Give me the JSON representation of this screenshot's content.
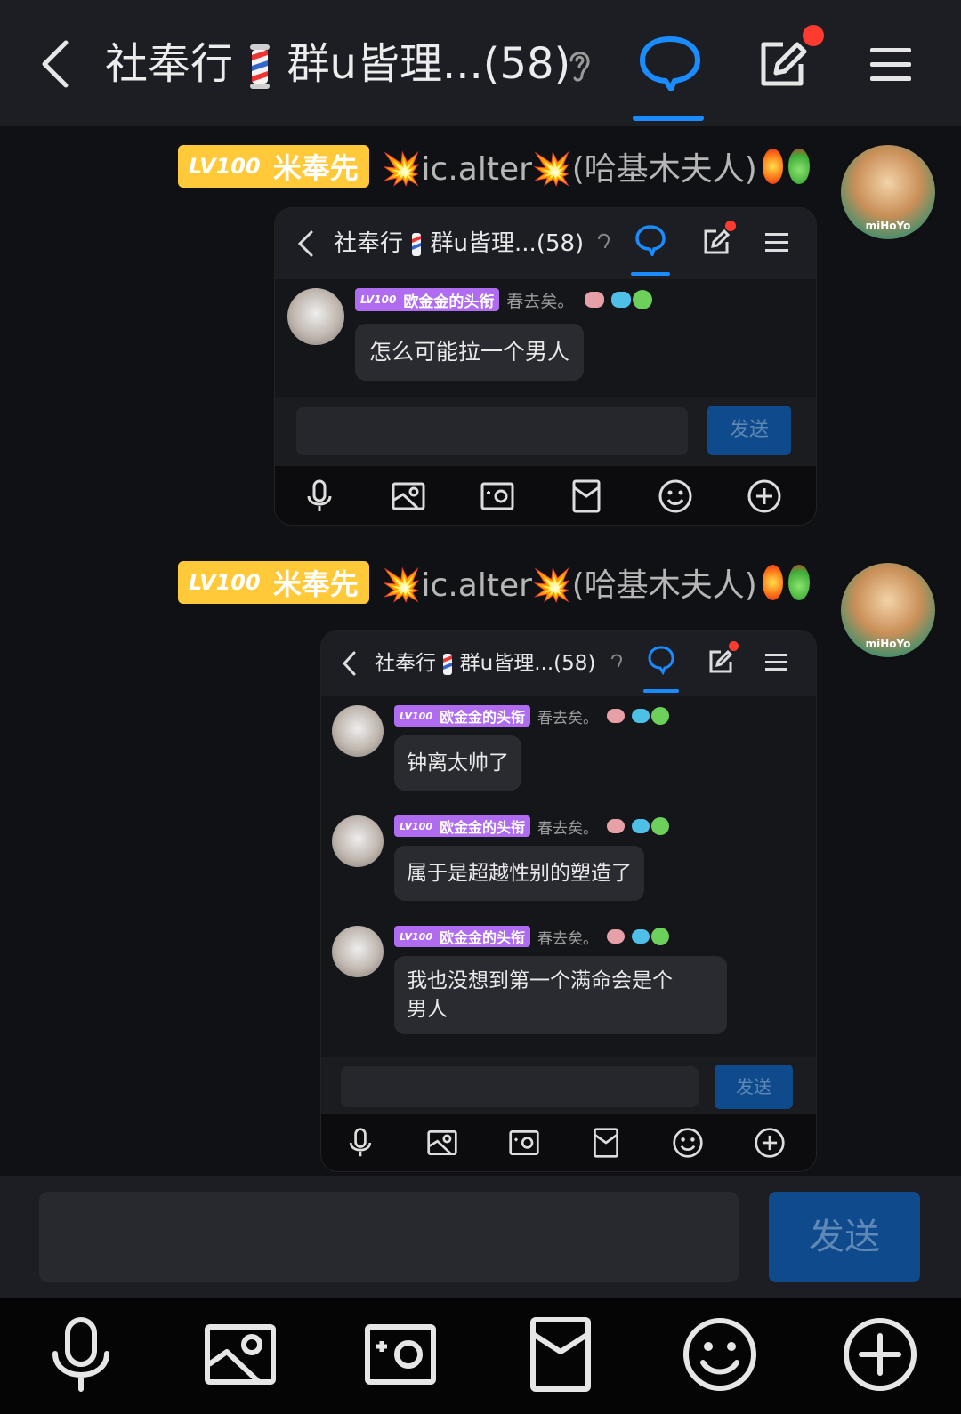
{
  "header": {
    "title_part1": "社奉行",
    "title_part2": "群u皆理...(58)",
    "notification_dot": true
  },
  "messages": [
    {
      "badge_level": "LV100",
      "badge_title": "米奉先",
      "sender": "💥ic.alter💥(哈基木夫人)",
      "embedded": {
        "title_part1": "社奉行",
        "title_part2": "群u皆理...(58)",
        "send_label": "发送",
        "posts": [
          {
            "badge_level": "LV100",
            "badge_title": "欧金金的头衔",
            "name": "春去矣。",
            "text": "怎么可能拉一个男人"
          }
        ]
      }
    },
    {
      "badge_level": "LV100",
      "badge_title": "米奉先",
      "sender": "💥ic.alter💥(哈基木夫人)",
      "embedded": {
        "title_part1": "社奉行",
        "title_part2": "群u皆理...(58)",
        "send_label": "发送",
        "posts": [
          {
            "badge_level": "LV100",
            "badge_title": "欧金金的头衔",
            "name": "春去矣。",
            "text": "钟离太帅了"
          },
          {
            "badge_level": "LV100",
            "badge_title": "欧金金的头衔",
            "name": "春去矣。",
            "text": "属于是超越性别的塑造了"
          },
          {
            "badge_level": "LV100",
            "badge_title": "欧金金的头衔",
            "name": "春去矣。",
            "text_line1": "我也没想到第一个满命会是个",
            "text_line2": "男人"
          }
        ]
      }
    }
  ],
  "avatar_mark": "miHoYo",
  "composer": {
    "send_label": "发送"
  },
  "toolbar": [
    "microphone-icon",
    "image-icon",
    "camera-icon",
    "red-packet-icon",
    "emoji-icon",
    "plus-icon"
  ],
  "colors": {
    "accent": "#1a8cff",
    "send_bg": "#0f4b8c",
    "badge_gold": "#ffc93a",
    "badge_purple": "#b06cf0",
    "notify_red": "#ff3b30"
  }
}
